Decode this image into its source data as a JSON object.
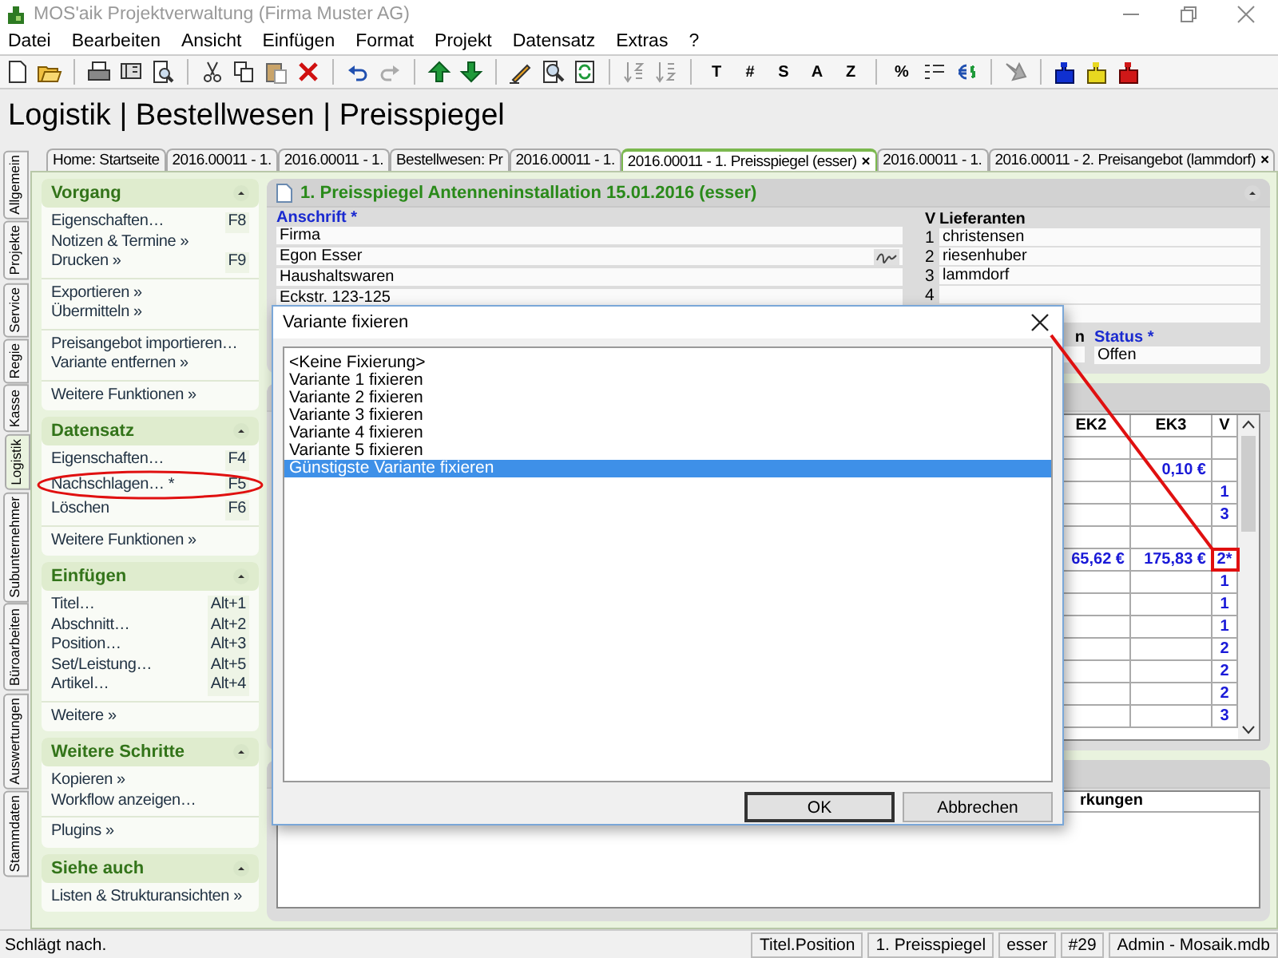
{
  "window": {
    "title": "MOS'aik Projektverwaltung (Firma Muster AG)"
  },
  "menu": [
    "Datei",
    "Bearbeiten",
    "Ansicht",
    "Einfügen",
    "Format",
    "Projekt",
    "Datensatz",
    "Extras",
    "?"
  ],
  "toolbar": [
    [
      {
        "kind": "icon"
      },
      {
        "kind": "icon"
      }
    ],
    [
      {
        "kind": "icon"
      },
      {
        "kind": "icon"
      },
      {
        "kind": "icon"
      }
    ],
    [
      {
        "kind": "icon"
      },
      {
        "kind": "icon"
      },
      {
        "kind": "icon"
      },
      {
        "kind": "icon"
      }
    ],
    [
      {
        "kind": "icon"
      },
      {
        "kind": "icon"
      }
    ],
    [
      {
        "kind": "icon"
      },
      {
        "kind": "icon"
      }
    ],
    [
      {
        "kind": "icon"
      },
      {
        "kind": "icon"
      },
      {
        "kind": "icon"
      }
    ],
    [
      {
        "kind": "icon"
      },
      {
        "kind": "icon"
      }
    ],
    [
      {
        "kind": "text",
        "label": "T"
      },
      {
        "kind": "text",
        "label": "#"
      },
      {
        "kind": "text",
        "label": "S"
      },
      {
        "kind": "text",
        "label": "A"
      },
      {
        "kind": "text",
        "label": "Z"
      }
    ],
    [
      {
        "kind": "text",
        "label": "%"
      },
      {
        "kind": "icon"
      },
      {
        "kind": "icon"
      }
    ],
    [
      {
        "kind": "icon"
      }
    ],
    [
      {
        "kind": "icon"
      },
      {
        "kind": "icon"
      },
      {
        "kind": "icon"
      }
    ]
  ],
  "breadcrumb": "Logistik | Bestellwesen | Preisspiegel",
  "side_tabs": [
    {
      "label": "Allgemein",
      "selected": false
    },
    {
      "label": "Projekte",
      "selected": false
    },
    {
      "label": "Service",
      "selected": false
    },
    {
      "label": "Regie",
      "selected": false
    },
    {
      "label": "Kasse",
      "selected": false
    },
    {
      "label": "Logistik",
      "selected": true
    },
    {
      "label": "Subunternehmer",
      "selected": false
    },
    {
      "label": "Büroarbeiten",
      "selected": false
    },
    {
      "label": "Auswertungen",
      "selected": false
    },
    {
      "label": "Stammdaten",
      "selected": false
    }
  ],
  "doc_tabs": [
    {
      "label": "Home: Startseite",
      "selected": false
    },
    {
      "label": "2016.00011 - 1.",
      "selected": false
    },
    {
      "label": "2016.00011 - 1.",
      "selected": false
    },
    {
      "label": "Bestellwesen: Pr",
      "selected": false
    },
    {
      "label": "2016.00011 - 1.",
      "selected": false
    },
    {
      "label": "2016.00011 - 1. Preisspiegel (esser)",
      "selected": true,
      "close": "×"
    },
    {
      "label": "2016.00011 - 1.",
      "selected": false
    },
    {
      "label": "2016.00011 - 2. Preisangebot (lammdorf)",
      "selected": false,
      "close": "×"
    }
  ],
  "sidebar": [
    {
      "title": "Vorgang",
      "expanded": true,
      "groups": [
        [
          {
            "label": "Eigenschaften…",
            "shortcut": "F8"
          },
          {
            "label": "Notizen & Termine »"
          },
          {
            "label": "Drucken »",
            "shortcut": "F9"
          }
        ],
        [
          {
            "label": "Exportieren »"
          },
          {
            "label": "Übermitteln »"
          }
        ],
        [
          {
            "label": "Preisangebot importieren…"
          },
          {
            "label": "Variante entfernen »"
          }
        ],
        [
          {
            "label": "Weitere Funktionen »"
          }
        ]
      ]
    },
    {
      "title": "Datensatz",
      "expanded": true,
      "groups": [
        [
          {
            "label": "Eigenschaften…",
            "shortcut": "F4"
          },
          {
            "label": "Nachschlagen… *",
            "shortcut": "F5"
          },
          {
            "label": "Löschen",
            "shortcut": "F6"
          }
        ],
        [
          {
            "label": "Weitere Funktionen »"
          }
        ]
      ]
    },
    {
      "title": "Einfügen",
      "expanded": true,
      "groups": [
        [
          {
            "label": "Titel…",
            "shortcut": "Alt+1"
          },
          {
            "label": "Abschnitt…",
            "shortcut": "Alt+2"
          },
          {
            "label": "Position…",
            "shortcut": "Alt+3"
          },
          {
            "label": "Set/Leistung…",
            "shortcut": "Alt+5"
          },
          {
            "label": "Artikel…",
            "shortcut": "Alt+4"
          }
        ],
        [
          {
            "label": "Weitere »"
          }
        ]
      ]
    },
    {
      "title": "Weitere Schritte",
      "expanded": true,
      "groups": [
        [
          {
            "label": "Kopieren »"
          },
          {
            "label": "Workflow anzeigen…"
          }
        ],
        [
          {
            "label": "Plugins »"
          }
        ]
      ]
    },
    {
      "title": "Siehe auch",
      "expanded": true,
      "groups": [
        [
          {
            "label": "Listen & Strukturansichten »"
          }
        ]
      ]
    }
  ],
  "document": {
    "title": "1. Preisspiegel Antenneninstallation 15.01.2016 (esser)",
    "address": {
      "label": "Anschrift *",
      "lines": [
        "Firma",
        "Egon Esser",
        "Haushaltswaren",
        "Eckstr. 123-125"
      ]
    },
    "suppliers": {
      "number_heading": "V",
      "heading": "Lieferanten",
      "rows": [
        {
          "number": "1",
          "name": "christensen"
        },
        {
          "number": "2",
          "name": "riesenhuber"
        },
        {
          "number": "3",
          "name": "lammdorf"
        },
        {
          "number": "4"
        },
        {}
      ]
    },
    "cut_label": "n",
    "status": {
      "label": "Status *",
      "value": "Offen"
    },
    "table": {
      "columns": [
        "EK2",
        "EK3",
        "V"
      ],
      "rows": [
        {},
        {
          "ek3": "0,10 €"
        },
        {
          "v": "1"
        },
        {
          "v": "3"
        },
        {},
        {
          "ek2": "65,62 €",
          "ek3": "175,83 €",
          "v": "2*"
        },
        {
          "v": "1"
        },
        {
          "v": "1"
        },
        {
          "v": "1"
        },
        {
          "v": "2"
        },
        {
          "v": "2"
        },
        {
          "v": "2"
        },
        {
          "v": "3"
        }
      ]
    },
    "notes_heading": "rkungen"
  },
  "dialog": {
    "title": "Variante fixieren",
    "options": [
      {
        "label": "<Keine Fixierung>",
        "selected": false
      },
      {
        "label": "Variante 1 fixieren",
        "selected": false
      },
      {
        "label": "Variante 2 fixieren",
        "selected": false
      },
      {
        "label": "Variante 3 fixieren",
        "selected": false
      },
      {
        "label": "Variante 4 fixieren",
        "selected": false
      },
      {
        "label": "Variante 5 fixieren",
        "selected": false
      },
      {
        "label": "Günstigste Variante fixieren",
        "selected": true
      }
    ],
    "buttons": [
      "OK",
      "Abbrechen"
    ]
  },
  "status_bar": {
    "message": "Schlägt nach.",
    "panels": [
      "Titel.Position",
      "1. Preisspiegel",
      "esser",
      "#29",
      "Admin - Mosaik.mdb"
    ]
  }
}
